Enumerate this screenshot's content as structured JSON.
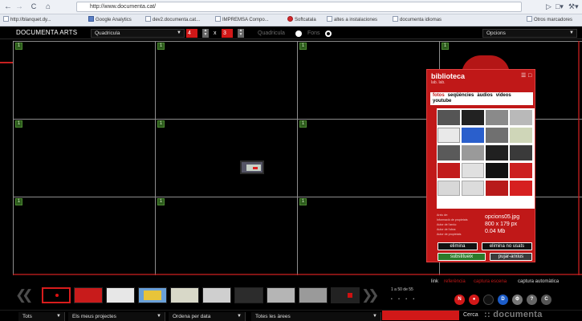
{
  "browser": {
    "url": "http://www.documenta.cat/",
    "bookmarks": [
      "http://blanquet.dy...",
      "Google Analytics",
      "dev2.documenta.cat...",
      "IMPREMSA Compo...",
      "Softcatala",
      "altes a instalaciones",
      "documenta idiomas"
    ],
    "other_bookmarks": "Otros marcadores"
  },
  "toolbar": {
    "logo": "DOCUMENTA ARTS",
    "layout_select": "Quadricula",
    "cols": "4",
    "x_sign": "x",
    "rows": "3",
    "mode_quadricula": "Quadricula",
    "mode_fons": "Fons",
    "options_select": "Opcions"
  },
  "grid": {
    "badge": "1"
  },
  "biblioteca": {
    "title": "biblioteca",
    "subtitle": "lab. lab.",
    "tabs": [
      "fotos",
      "seqüències",
      "àudios",
      "vídeos",
      "youtube"
    ],
    "active_tab": "fotos",
    "meta_lines": [
      "Arxiu de:",
      "Informació de propietats",
      "Autor de l'arxiu:",
      "Autor de l'obra:",
      "Autor de propietats"
    ],
    "file_name": "opcions05.jpg",
    "file_dims": "800 x 179 px",
    "file_size": "0.04 Mb",
    "btn_delete": "elimina",
    "btn_delete_unused": "elimina no usats",
    "btn_replace": "substitueix",
    "btn_upload": "pujar-arxius"
  },
  "timeline": {
    "mode_link": "link",
    "mode_reference": "referència",
    "mode_screen": "captura escena",
    "mode_auto": "captura automàtica",
    "count": "1 a 50 de 55",
    "dots": "• • • •"
  },
  "bottom": {
    "filter_all": "Tots",
    "projects": "Els meus projectes",
    "order": "Ordena per data",
    "areas": "Totes les àrees",
    "search_label": "Cerca",
    "brand": ":: documenta"
  },
  "colors": {
    "accent": "#c01818",
    "green_badge": "#2c5a1c"
  }
}
